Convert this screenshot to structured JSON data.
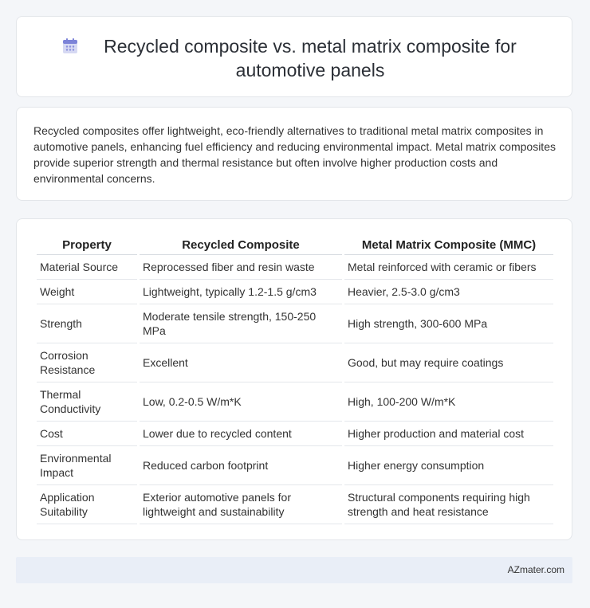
{
  "header": {
    "title": "Recycled composite vs. metal matrix composite for automotive panels",
    "icon": "calendar-icon",
    "icon_colors": {
      "header": "#7c83d8",
      "body": "#d6d9f3",
      "dots": "#8a90dc"
    }
  },
  "intro": {
    "text": "Recycled composites offer lightweight, eco-friendly alternatives to traditional metal matrix composites in automotive panels, enhancing fuel efficiency and reducing environmental impact. Metal matrix composites provide superior strength and thermal resistance but often involve higher production costs and environmental concerns."
  },
  "table": {
    "headers": [
      "Property",
      "Recycled Composite",
      "Metal Matrix Composite (MMC)"
    ],
    "rows": [
      [
        "Material Source",
        "Reprocessed fiber and resin waste",
        "Metal reinforced with ceramic or fibers"
      ],
      [
        "Weight",
        "Lightweight, typically 1.2-1.5 g/cm3",
        "Heavier, 2.5-3.0 g/cm3"
      ],
      [
        "Strength",
        "Moderate tensile strength, 150-250 MPa",
        "High strength, 300-600 MPa"
      ],
      [
        "Corrosion Resistance",
        "Excellent",
        "Good, but may require coatings"
      ],
      [
        "Thermal Conductivity",
        "Low, 0.2-0.5 W/m*K",
        "High, 100-200 W/m*K"
      ],
      [
        "Cost",
        "Lower due to recycled content",
        "Higher production and material cost"
      ],
      [
        "Environmental Impact",
        "Reduced carbon footprint",
        "Higher energy consumption"
      ],
      [
        "Application Suitability",
        "Exterior automotive panels for lightweight and sustainability",
        "Structural components requiring high strength and heat resistance"
      ]
    ]
  },
  "footer": {
    "text": "AZmater.com"
  }
}
